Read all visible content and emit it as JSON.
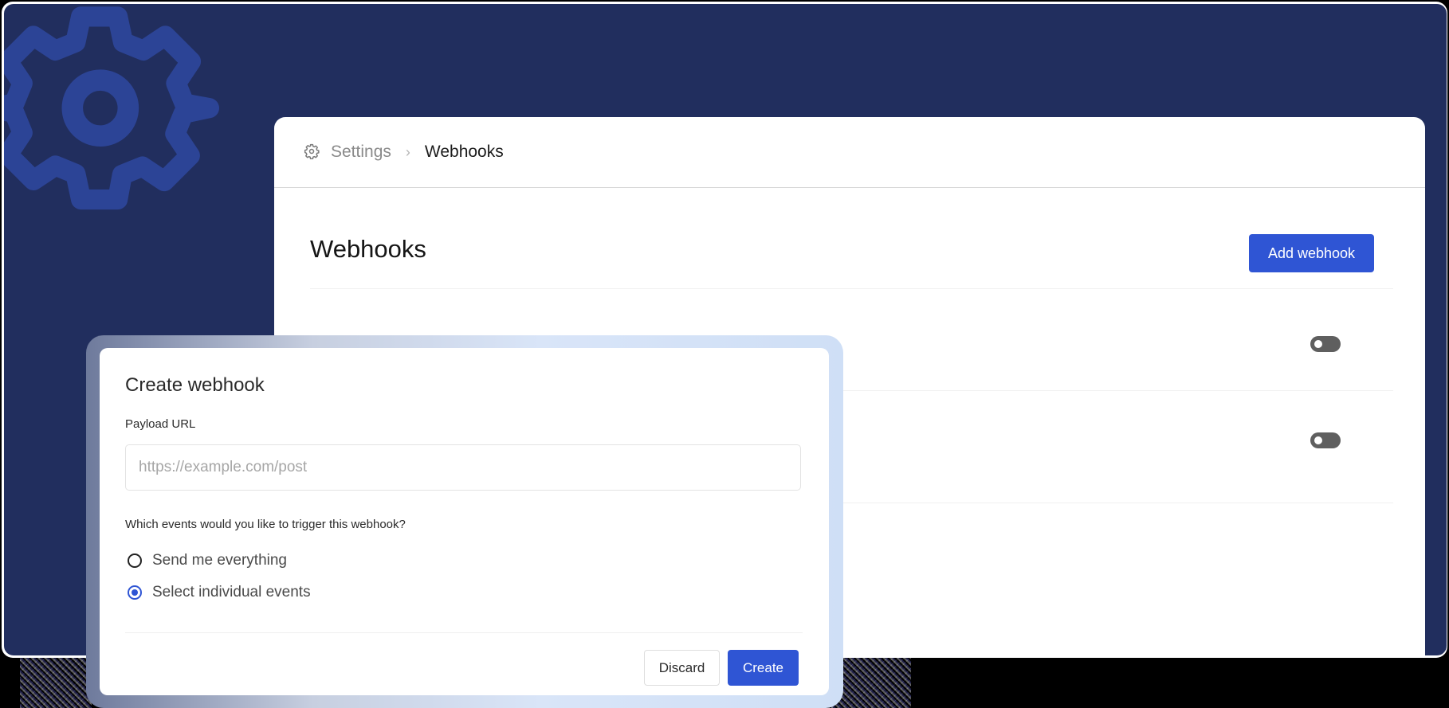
{
  "breadcrumb": {
    "settings_icon": "gear-icon",
    "settings_label": "Settings",
    "separator": "›",
    "current_label": "Webhooks"
  },
  "main": {
    "title": "Webhooks",
    "add_button_label": "Add webhook",
    "rows": [
      {
        "toggle_on": false
      },
      {
        "toggle_on": false
      }
    ]
  },
  "modal": {
    "title": "Create webhook",
    "payload_url_label": "Payload URL",
    "payload_url_value": "",
    "payload_url_placeholder": "https://example.com/post",
    "events_question": "Which events would you like to trigger this webhook?",
    "options": [
      {
        "label": "Send me everything",
        "selected": false
      },
      {
        "label": "Select individual events",
        "selected": true
      }
    ],
    "discard_label": "Discard",
    "create_label": "Create"
  },
  "colors": {
    "background": "#212e5e",
    "accent": "#2f55d4",
    "toggle_off": "#5f5f5f"
  }
}
